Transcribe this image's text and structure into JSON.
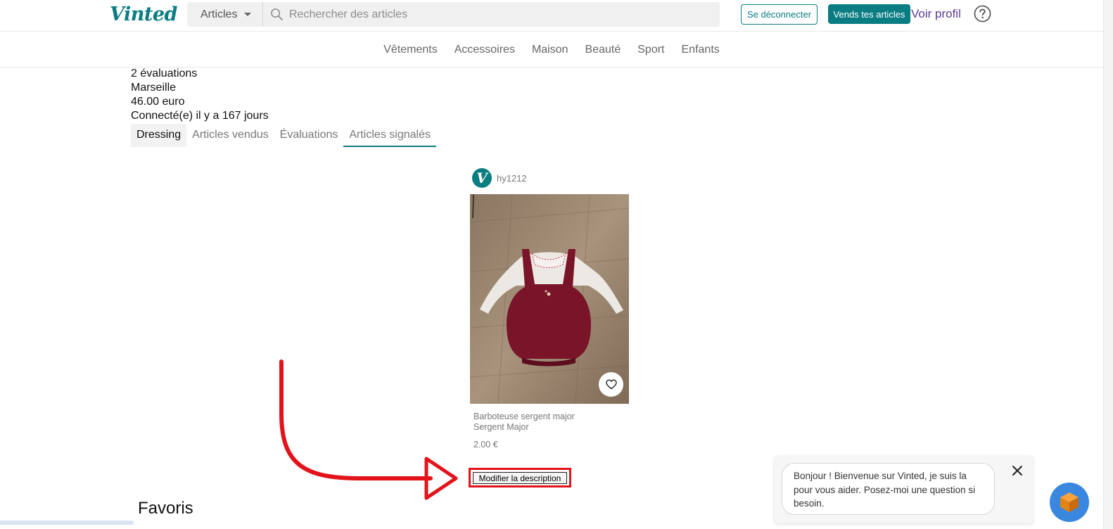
{
  "header": {
    "logo": "Vinted",
    "category_select": "Articles",
    "search_placeholder": "Rechercher des articles",
    "logout_label": "Se déconnecter",
    "sell_label": "Vends tes articles",
    "profile_label": "Voir profil"
  },
  "catnav": [
    "Vêtements",
    "Accessoires",
    "Maison",
    "Beauté",
    "Sport",
    "Enfants"
  ],
  "profile": {
    "ratings": "2 évaluations",
    "city": "Marseille",
    "balance": "46.00 euro",
    "last_seen": "Connecté(e) il y a 167 jours"
  },
  "tabs": [
    "Dressing",
    "Articles vendus",
    "Évaluations",
    "Articles signalés"
  ],
  "item": {
    "owner_initial": "V",
    "owner": "hy1212",
    "title": "Barboteuse sergent major",
    "brand": "Sergent Major",
    "price": "2.00 €",
    "edit_label": "Modifier la description"
  },
  "favorites_heading": "Favoris",
  "chat": {
    "message": "Bonjour ! Bienvenue sur Vinted, je suis la pour vous aider. Posez-moi une question si besoin."
  },
  "colors": {
    "brand": "#0a7d82",
    "annotation": "#e3131b",
    "profile_link": "#5b3b96",
    "chat_launcher": "#3a87e0"
  }
}
